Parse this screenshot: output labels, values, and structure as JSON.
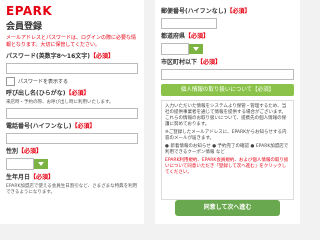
{
  "left": {
    "logo": "EPARK",
    "title": "会員登録",
    "note": "メールアドレスとパスワードは、ログインの際に必要な情報となります。大切に保管してください。",
    "password_label": "パスワード(英数字8〜16文字)",
    "required": "【必須】",
    "show_password": "パスワードを表示する",
    "nickname_label": "呼び出し名(ひらがな)",
    "nickname_help": "来店時・予約の際、お呼び出し時に利用いたします。",
    "phone_label": "電話番号(ハイフンなし)",
    "gender_label": "性別",
    "birthday_label": "生年月日",
    "birthday_help": "EPARK加盟店で使える会員生日割引など、さまざまな特典を利用できるようになります。"
  },
  "right": {
    "postal_label": "郵便番号(ハイフンなし)",
    "prefecture_label": "都道府県",
    "city_label": "市区町村以下",
    "privacy_bar": "個人情報の取り扱いについて【必須】",
    "privacy_p1": "入力いただいた情報をシステムより保管・管理するため、当社の提供事業者を通じて情報を提供する場合がございます。これらの情報のお取り扱いについて、提携先の個人情報の保護に努めております。",
    "privacy_p2": "※ご登録したメールアドレスに、EPARKからお知らせする内容のメールが届きます。",
    "privacy_items": "● 新着情報のお知らせ ● 予約完了の確認 ● EPARK加盟店で利用できるクーポン情報 など",
    "privacy_terms": "EPARK利用規約、EPARK会員規約、および個人情報の取り扱いについて同意いただき「登録して次へ進む」をクリックしてください。",
    "submit": "同意して次へ進む"
  }
}
